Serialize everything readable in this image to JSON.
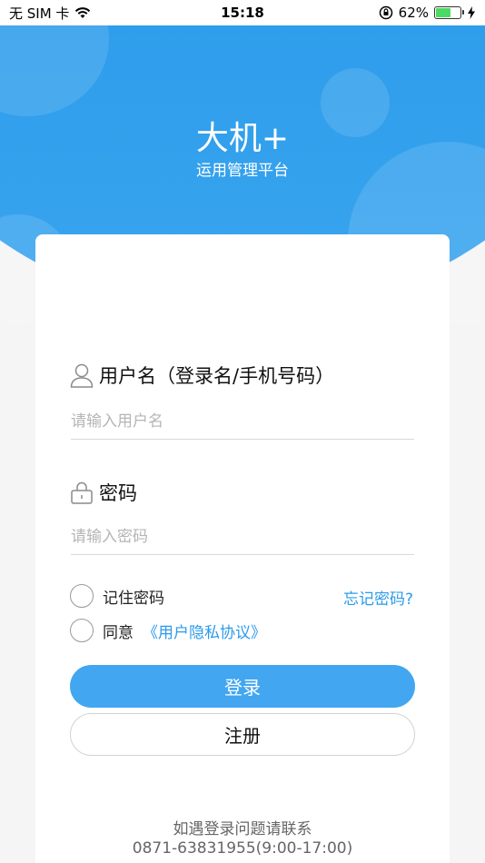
{
  "status_bar": {
    "carrier": "无 SIM 卡",
    "time": "15:18",
    "battery_percent": "62%",
    "battery_level": 0.62
  },
  "header": {
    "title": "大机+",
    "subtitle": "运用管理平台"
  },
  "form": {
    "username_label": "用户名（登录名/手机号码）",
    "username_placeholder": "请输入用户名",
    "password_label": "密码",
    "password_placeholder": "请输入密码",
    "remember_label": "记住密码",
    "forgot_link": "忘记密码?",
    "agree_label": "同意",
    "privacy_link": "《用户隐私协议》",
    "login_button": "登录",
    "register_button": "注册"
  },
  "footer": {
    "help_text": "如遇登录问题请联系",
    "phone_text": "0871-63831955(9:00-17:00)"
  },
  "colors": {
    "primary": "#2b9bea",
    "button": "#42a6f0"
  }
}
